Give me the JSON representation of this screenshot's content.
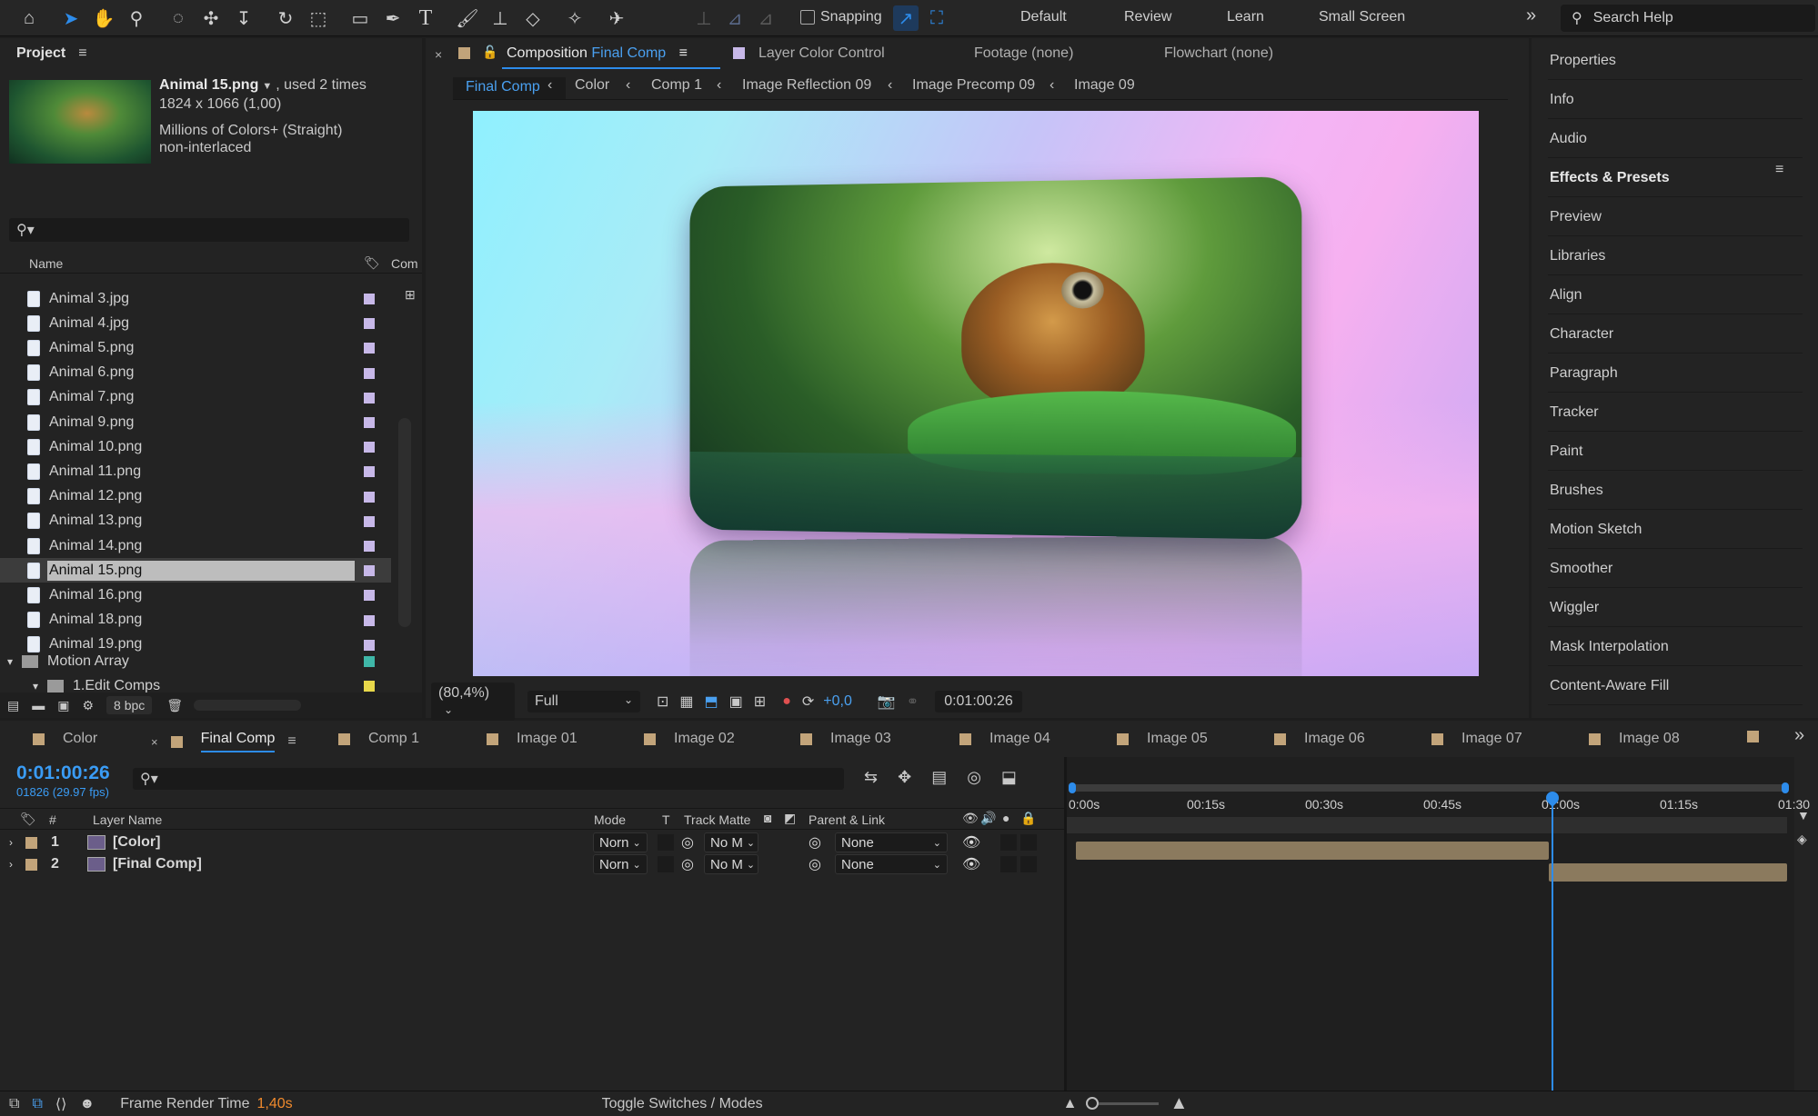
{
  "toolbar": {
    "snapping_label": "Snapping",
    "workspaces": [
      "Default",
      "Review",
      "Learn",
      "Small Screen"
    ],
    "search_placeholder": "Search Help"
  },
  "project": {
    "title": "Project",
    "selected_name": "Animal 15.png",
    "used": ", used 2 times",
    "dimensions": "1824 x 1066 (1,00)",
    "color_info": "Millions of Colors+ (Straight)",
    "interlace": "non-interlaced",
    "col_name": "Name",
    "col_comment": "Com",
    "items": [
      "Animal 3.jpg",
      "Animal 4.jpg",
      "Animal 5.png",
      "Animal 6.png",
      "Animal 7.png",
      "Animal 9.png",
      "Animal 10.png",
      "Animal 11.png",
      "Animal 12.png",
      "Animal 13.png",
      "Animal 14.png",
      "Animal 15.png",
      "Animal 16.png",
      "Animal 18.png",
      "Animal 19.png"
    ],
    "folder": "Motion Array",
    "subfolder": "1.Edit Comps",
    "bpc": "8 bpc",
    "label_color": "#c7b8e8",
    "folder_color": "#3fb7a8",
    "subfolder_color": "#e8d84a"
  },
  "viewer": {
    "tab_prefix": "Composition",
    "tab_comp": "Final Comp",
    "tab_layer": "Layer Color Control",
    "tab_footage": "Footage (none)",
    "tab_flowchart": "Flowchart (none)",
    "breadcrumbs": [
      "Final Comp",
      "Color",
      "Comp 1",
      "Image Reflection 09",
      "Image Precomp 09",
      "Image 09"
    ],
    "zoom": "(80,4%)",
    "resolution": "Full",
    "exposure": "+0,0",
    "timecode": "0:01:00:26"
  },
  "right_panels": [
    "Properties",
    "Info",
    "Audio",
    "Effects & Presets",
    "Preview",
    "Libraries",
    "Align",
    "Character",
    "Paragraph",
    "Tracker",
    "Paint",
    "Brushes",
    "Motion Sketch",
    "Smoother",
    "Wiggler",
    "Mask Interpolation",
    "Content-Aware Fill"
  ],
  "timeline": {
    "tabs": [
      "Color",
      "Final Comp",
      "Comp 1",
      "Image 01",
      "Image 02",
      "Image 03",
      "Image 04",
      "Image 05",
      "Image 06",
      "Image 07",
      "Image 08"
    ],
    "timecode": "0:01:00:26",
    "frames": "01826 (29.97 fps)",
    "columns": {
      "num": "#",
      "layer_name": "Layer Name",
      "mode": "Mode",
      "t": "T",
      "track_matte": "Track Matte",
      "parent": "Parent & Link"
    },
    "layers": [
      {
        "num": "1",
        "name": "[Color]",
        "mode": "Norn",
        "matte": "No M",
        "parent": "None"
      },
      {
        "num": "2",
        "name": "[Final Comp]",
        "mode": "Norn",
        "matte": "No M",
        "parent": "None"
      }
    ],
    "ruler": [
      "0:00s",
      "00:15s",
      "00:30s",
      "00:45s",
      "01:00s",
      "01:15s",
      "01:30"
    ],
    "playhead_progress": 0.673
  },
  "status": {
    "render_label": "Frame Render Time",
    "render_value": "1,40s",
    "toggle": "Toggle Switches / Modes"
  },
  "colors": {
    "accent": "#2d8ceb",
    "label_tan": "#c2a47a",
    "render_time": "#f08a2d"
  }
}
